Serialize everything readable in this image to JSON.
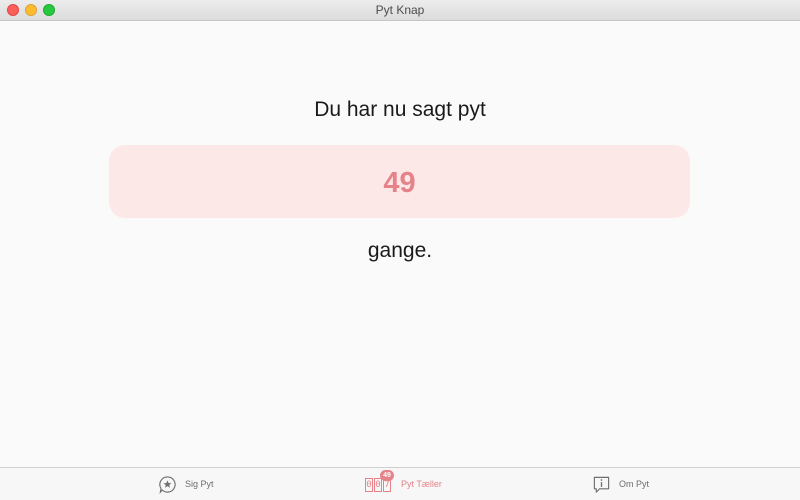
{
  "window": {
    "title": "Pyt Knap"
  },
  "main": {
    "headline": "Du har nu sagt pyt",
    "count": "49",
    "suffix": "gange."
  },
  "tabs": [
    {
      "label": "Sig Pyt",
      "icon": "star-bubble-icon",
      "active": false
    },
    {
      "label": "Pyt Tæller",
      "icon": "counter-icon",
      "active": true,
      "badge": "49",
      "digits": [
        "0",
        "0",
        "7"
      ]
    },
    {
      "label": "Om Pyt",
      "icon": "info-bubble-icon",
      "active": false
    }
  ],
  "colors": {
    "accent": "#e6828a",
    "counter_background": "#fde8e8"
  }
}
